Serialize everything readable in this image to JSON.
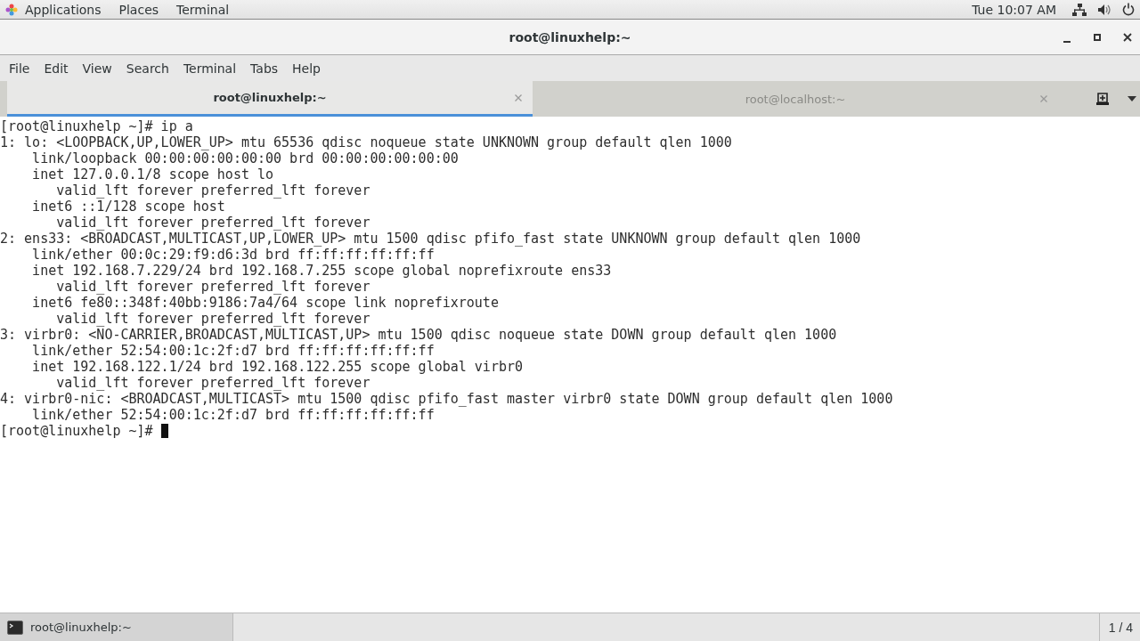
{
  "top_panel": {
    "menus": [
      "Applications",
      "Places",
      "Terminal"
    ],
    "clock": "Tue 10:07 AM"
  },
  "window": {
    "title": "root@linuxhelp:~"
  },
  "menu_bar": [
    "File",
    "Edit",
    "View",
    "Search",
    "Terminal",
    "Tabs",
    "Help"
  ],
  "tabs": [
    {
      "label": "root@linuxhelp:~",
      "selected": true
    },
    {
      "label": "root@localhost:~",
      "selected": false
    }
  ],
  "terminal": {
    "lines": [
      "[root@linuxhelp ~]# ip a",
      "1: lo: <LOOPBACK,UP,LOWER_UP> mtu 65536 qdisc noqueue state UNKNOWN group default qlen 1000",
      "    link/loopback 00:00:00:00:00:00 brd 00:00:00:00:00:00",
      "    inet 127.0.0.1/8 scope host lo",
      "       valid_lft forever preferred_lft forever",
      "    inet6 ::1/128 scope host",
      "       valid_lft forever preferred_lft forever",
      "2: ens33: <BROADCAST,MULTICAST,UP,LOWER_UP> mtu 1500 qdisc pfifo_fast state UNKNOWN group default qlen 1000",
      "    link/ether 00:0c:29:f9:d6:3d brd ff:ff:ff:ff:ff:ff",
      "    inet 192.168.7.229/24 brd 192.168.7.255 scope global noprefixroute ens33",
      "       valid_lft forever preferred_lft forever",
      "    inet6 fe80::348f:40bb:9186:7a4/64 scope link noprefixroute",
      "       valid_lft forever preferred_lft forever",
      "3: virbr0: <NO-CARRIER,BROADCAST,MULTICAST,UP> mtu 1500 qdisc noqueue state DOWN group default qlen 1000",
      "    link/ether 52:54:00:1c:2f:d7 brd ff:ff:ff:ff:ff:ff",
      "    inet 192.168.122.1/24 brd 192.168.122.255 scope global virbr0",
      "       valid_lft forever preferred_lft forever",
      "4: virbr0-nic: <BROADCAST,MULTICAST> mtu 1500 qdisc pfifo_fast master virbr0 state DOWN group default qlen 1000",
      "    link/ether 52:54:00:1c:2f:d7 brd ff:ff:ff:ff:ff:ff"
    ],
    "prompt": "[root@linuxhelp ~]#"
  },
  "taskbar": {
    "window_button": "root@linuxhelp:~",
    "workspace": "1 / 4"
  }
}
